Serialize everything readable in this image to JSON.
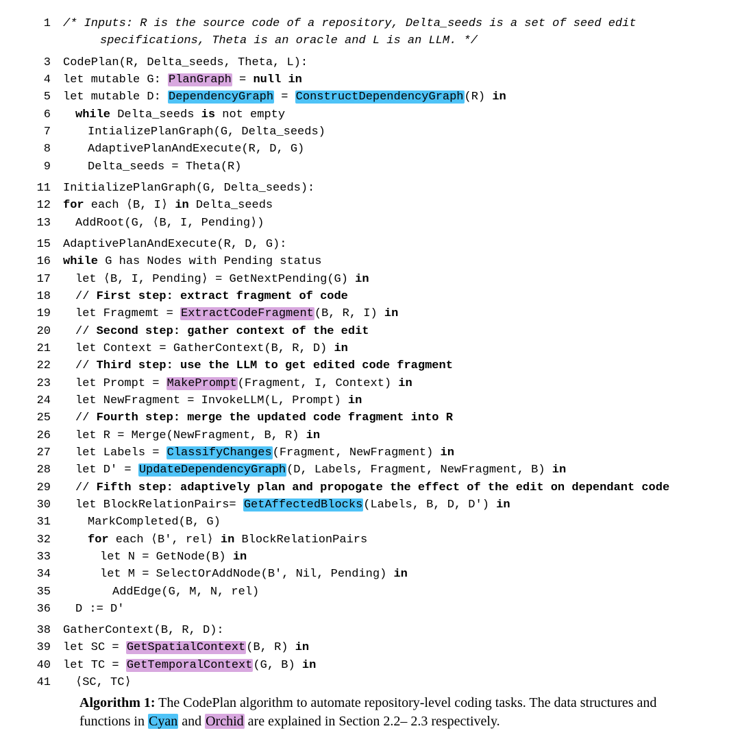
{
  "lines": {
    "l1a": "/* Inputs: R is the source code of a repository, Delta_seeds is a set of seed edit",
    "l1b": "specifications, Theta is an oracle and L is an LLM. */",
    "l3": "CodePlan(R, Delta_seeds, Theta, L):",
    "l4_a": "let mutable G: ",
    "l4_hl": "PlanGraph",
    "l4_b": " = ",
    "l4_null": "null",
    "l4_in": " in",
    "l5_a": "let mutable D: ",
    "l5_hl1": "DependencyGraph",
    "l5_b": " = ",
    "l5_hl2": "ConstructDependencyGraph",
    "l5_c": "(R) ",
    "l5_in": "in",
    "l6_kw1": "while",
    "l6_a": " Delta_seeds ",
    "l6_kw2": "is",
    "l6_b": " not empty",
    "l7": "IntializePlanGraph(G, Delta_seeds)",
    "l8": "AdaptivePlanAndExecute(R, D, G)",
    "l9": "Delta_seeds = Theta(R)",
    "l11": "InitializePlanGraph(G, Delta_seeds):",
    "l12_kw": "for",
    "l12_a": " each ⟨B, I⟩ ",
    "l12_kw2": "in",
    "l12_b": " Delta_seeds",
    "l13": "AddRoot(G, ⟨B, I, Pending⟩)",
    "l15": "AdaptivePlanAndExecute(R, D, G):",
    "l16_kw": "while",
    "l16_a": " G has Nodes with Pending status",
    "l17_a": "let ⟨B, I, Pending⟩ = GetNextPending(G) ",
    "l17_in": "in",
    "l18_a": "// ",
    "l18_b": "First step: extract fragment of code",
    "l19_a": "let Fragmemt = ",
    "l19_hl": "ExtractCodeFragment",
    "l19_b": "(B, R, I) ",
    "l19_in": "in",
    "l20_a": "// ",
    "l20_b": "Second step: gather context of the edit",
    "l21_a": "let Context = GatherContext(B, R, D) ",
    "l21_in": "in",
    "l22_a": "// ",
    "l22_b": "Third step: use the LLM to get edited code fragment",
    "l23_a": "let Prompt = ",
    "l23_hl": "MakePrompt",
    "l23_b": "(Fragment, I, Context) ",
    "l23_in": "in",
    "l24_a": "let NewFragment = InvokeLLM(L, Prompt) ",
    "l24_in": "in",
    "l25_a": "// ",
    "l25_b": "Fourth step: merge the updated code fragment into R",
    "l26_a": "let R = Merge(NewFragment, B, R) ",
    "l26_in": "in",
    "l27_a": "let Labels = ",
    "l27_hl": "ClassifyChanges",
    "l27_b": "(Fragment, NewFragment) ",
    "l27_in": "in",
    "l28_a": "let D' = ",
    "l28_hl": "UpdateDependencyGraph",
    "l28_b": "(D, Labels, Fragment, NewFragment, B) ",
    "l28_in": "in",
    "l29_a": "// ",
    "l29_b": "Fifth step: adaptively plan and propogate the effect of the edit on dependant code",
    "l30_a": "let BlockRelationPairs= ",
    "l30_hl": "GetAffectedBlocks",
    "l30_b": "(Labels, B, D, D') ",
    "l30_in": "in",
    "l31": "MarkCompleted(B, G)",
    "l32_kw": "for",
    "l32_a": " each ⟨B′, rel⟩ ",
    "l32_kw2": "in",
    "l32_b": " BlockRelationPairs",
    "l33_a": "let N = GetNode(B) ",
    "l33_in": "in",
    "l34_a": "let M = SelectOrAddNode(B', Nil, Pending) ",
    "l34_in": "in",
    "l35": "AddEdge(G, M, N, rel)",
    "l36": "D := D'",
    "l38": "GatherContext(B, R, D):",
    "l39_a": "let SC = ",
    "l39_hl": "GetSpatialContext",
    "l39_b": "(B, R) ",
    "l39_in": "in",
    "l40_a": "let TC = ",
    "l40_hl": "GetTemporalContext",
    "l40_b": "(G, B) ",
    "l40_in": "in",
    "l41": "⟨SC, TC⟩"
  },
  "nums": {
    "n1": "1",
    "n3": "3",
    "n4": "4",
    "n5": "5",
    "n6": "6",
    "n7": "7",
    "n8": "8",
    "n9": "9",
    "n11": "11",
    "n12": "12",
    "n13": "13",
    "n15": "15",
    "n16": "16",
    "n17": "17",
    "n18": "18",
    "n19": "19",
    "n20": "20",
    "n21": "21",
    "n22": "22",
    "n23": "23",
    "n24": "24",
    "n25": "25",
    "n26": "26",
    "n27": "27",
    "n28": "28",
    "n29": "29",
    "n30": "30",
    "n31": "31",
    "n32": "32",
    "n33": "33",
    "n34": "34",
    "n35": "35",
    "n36": "36",
    "n38": "38",
    "n39": "39",
    "n40": "40",
    "n41": "41"
  },
  "caption": {
    "lead": "Algorithm 1:",
    "body1": " The CodePlan algorithm to automate repository-level coding tasks. The data structures and functions in ",
    "cyan": "Cyan",
    "and": " and ",
    "orchid": "Orchid",
    "body2": " are explained in Section 2.2– 2.3 respectively."
  }
}
